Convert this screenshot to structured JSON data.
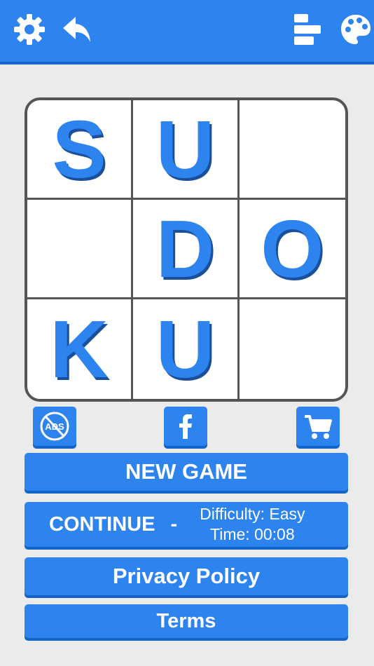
{
  "board": {
    "cells": [
      [
        "S",
        "U",
        ""
      ],
      [
        "",
        "D",
        "O"
      ],
      [
        "K",
        "U",
        ""
      ]
    ]
  },
  "actions": {
    "new_game": "NEW GAME",
    "continue_label": "CONTINUE",
    "continue_separator": "-",
    "difficulty": "Difficulty: Easy",
    "time": "Time: 00:08",
    "privacy": "Privacy Policy",
    "terms": "Terms"
  },
  "icons": {
    "settings": "gear-icon",
    "back": "undo-icon",
    "stats": "leaderboard-icon",
    "theme": "palette-icon",
    "no_ads": "no-ads-icon",
    "no_ads_text": "ADS",
    "facebook": "facebook-icon",
    "shop": "cart-icon"
  },
  "colors": {
    "primary": "#2d84ee",
    "primary_dark": "#1565c8",
    "background": "#ebebeb",
    "grid_line": "#555555"
  }
}
